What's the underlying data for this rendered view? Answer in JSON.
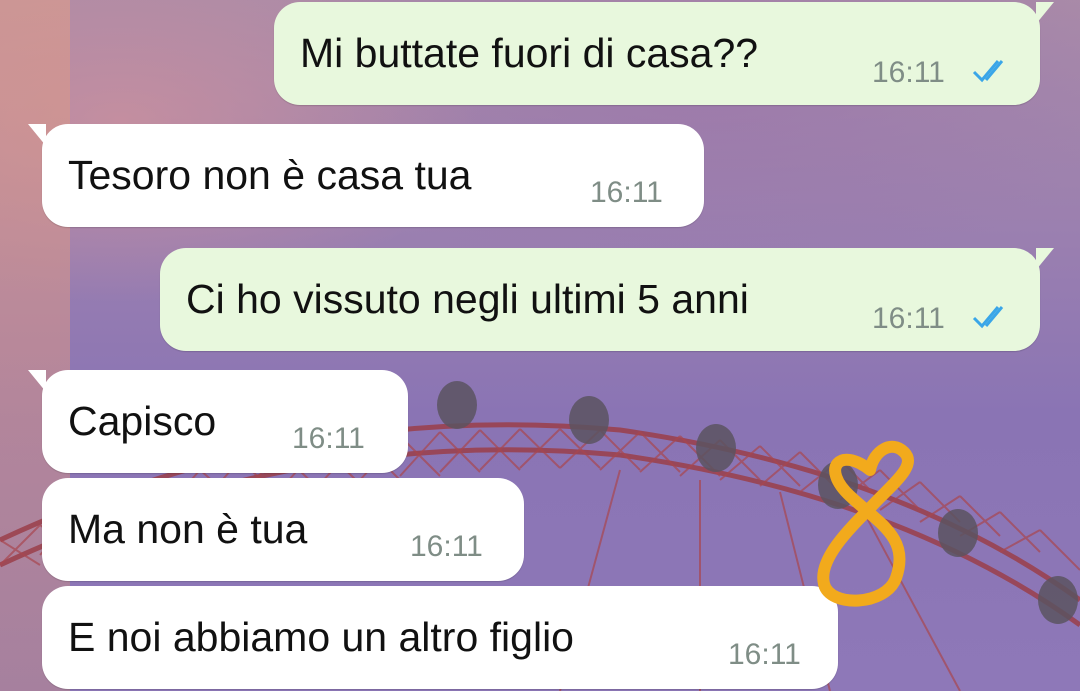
{
  "chat": {
    "messages": [
      {
        "direction": "outgoing",
        "text": "Mi buttate fuori di casa??",
        "time": "16:11",
        "status_icon": "double-check-icon"
      },
      {
        "direction": "incoming",
        "text": "Tesoro non è casa tua",
        "time": "16:11"
      },
      {
        "direction": "outgoing",
        "text": "Ci ho vissuto negli ultimi 5 anni",
        "time": "16:11",
        "status_icon": "double-check-icon"
      },
      {
        "direction": "incoming",
        "text": "Capisco",
        "time": "16:11"
      },
      {
        "direction": "incoming",
        "text": "Ma non è tua",
        "time": "16:11"
      },
      {
        "direction": "incoming",
        "text": "E noi abbiamo un altro figlio",
        "time": "16:11"
      }
    ]
  },
  "colors": {
    "outgoing_bubble": "#e8f8dd",
    "incoming_bubble": "#ffffff",
    "read_receipt": "#3aa6e8",
    "annotation": "#f2aa1c"
  },
  "annotation": {
    "drawing": "handwritten digit 8",
    "color": "#f2aa1c"
  }
}
